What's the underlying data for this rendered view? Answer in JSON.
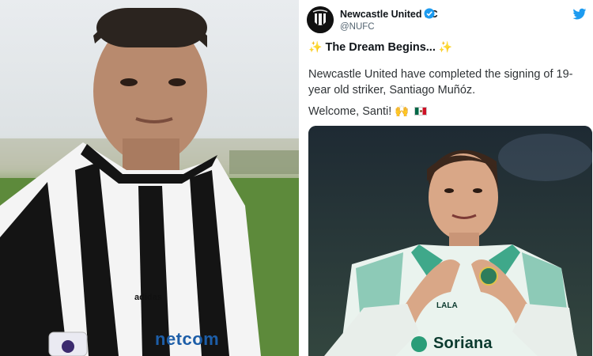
{
  "left_image": {
    "description_icon": "player-photo",
    "kit_brand": "adidas",
    "sponsor": "netcom"
  },
  "tweet": {
    "account_name": "Newcastle United FC",
    "handle": "@NUFC",
    "verified": true,
    "title": "The Dream Begins...",
    "title_emoji_left": "✨",
    "title_emoji_right": "✨",
    "body": "Newcastle United have completed the signing of 19-year old striker, Santiago Muñóz.",
    "welcome": "Welcome, Santi!",
    "welcome_emoji": "🙌",
    "media": {
      "sponsor": "Soriana",
      "chest_text": "LALA"
    }
  },
  "colors": {
    "twitter_blue": "#1d9bf0",
    "text_primary": "#0f1419",
    "text_secondary": "#536471",
    "santos_green": "#3fa88a"
  }
}
